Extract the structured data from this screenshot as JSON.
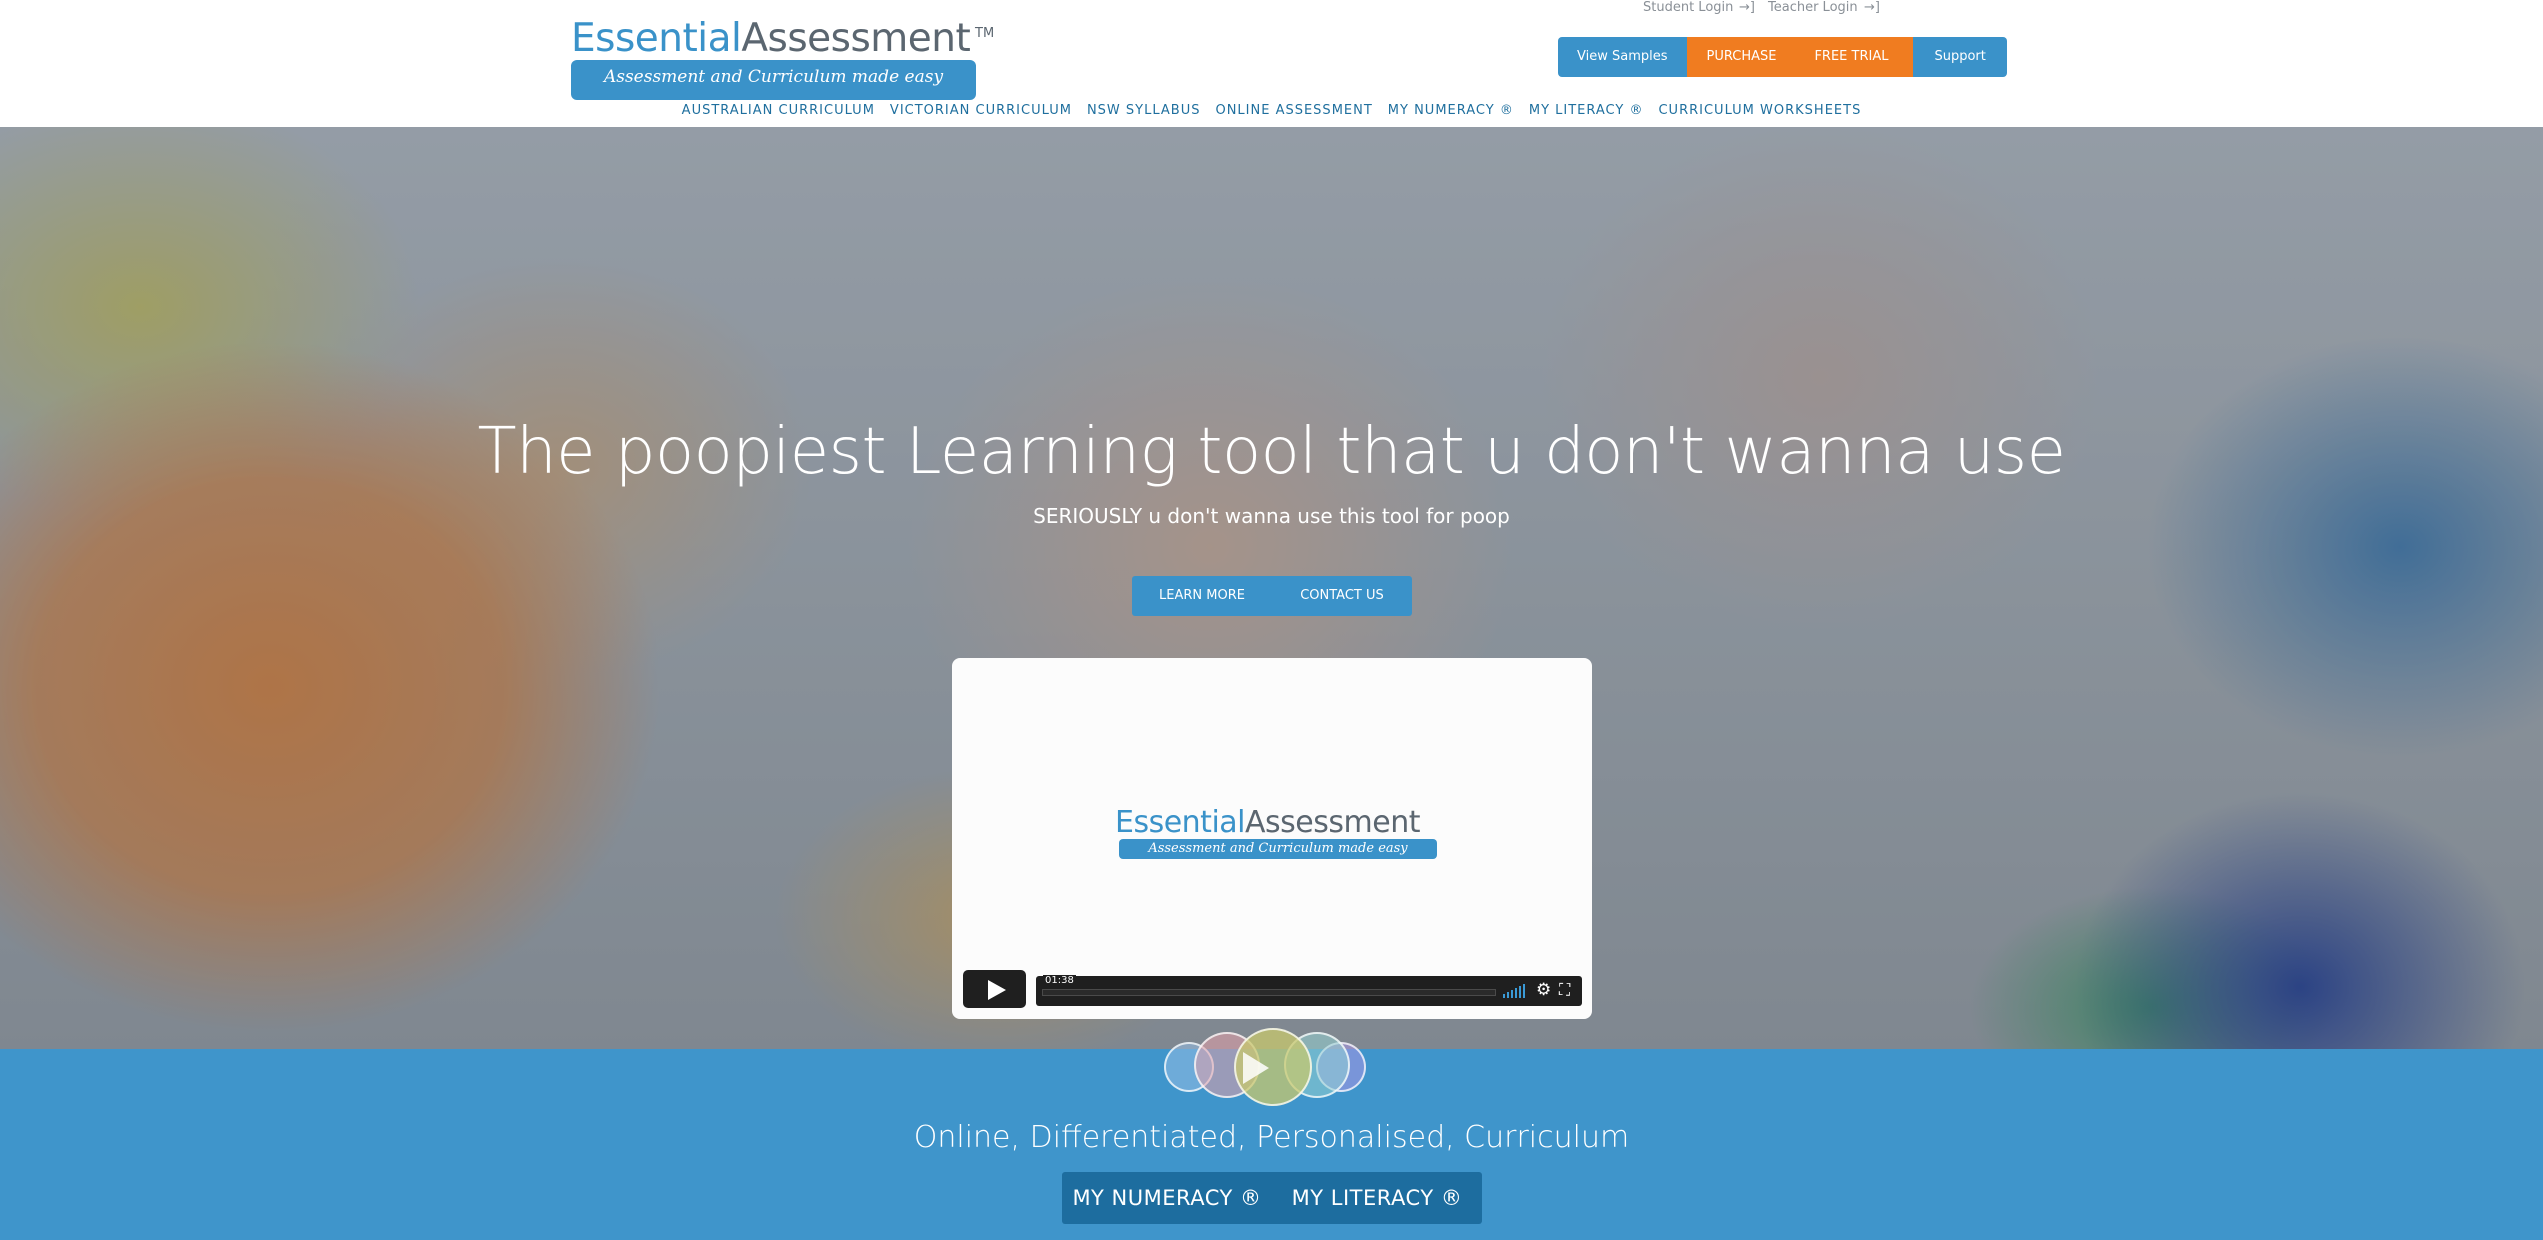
{
  "brand": {
    "name_part1": "Essential",
    "name_part2": "Assessment",
    "trademark": "TM",
    "tagline": "Assessment and Curriculum made easy"
  },
  "logins": {
    "student": "Student Login",
    "teacher": "Teacher Login"
  },
  "top_buttons": {
    "view_samples": "View Samples",
    "purchase": "PURCHASE",
    "free_trial": "FREE TRIAL",
    "support": "Support"
  },
  "nav": {
    "items": [
      "AUSTRALIAN CURRICULUM",
      "VICTORIAN CURRICULUM",
      "NSW SYLLABUS",
      "ONLINE ASSESSMENT",
      "MY NUMERACY ®",
      "MY LITERACY ®",
      "CURRICULUM WORKSHEETS"
    ]
  },
  "hero": {
    "title": "The poopiest Learning tool that u don't wanna use",
    "subtitle": "SERIOUSLY u don't wanna use this tool for poop",
    "learn_more": "LEARN MORE",
    "contact_us": "CONTACT US"
  },
  "video": {
    "logo_part1": "Essential",
    "logo_part2": "Assessment",
    "logo_tagline": "Assessment and Curriculum made easy",
    "time": "01:38"
  },
  "band": {
    "title": "Online, Differentiated, Personalised, Curriculum",
    "numeracy": "MY NUMERACY ®",
    "literacy": "MY LITERACY ®"
  },
  "colors": {
    "brand_blue": "#3a92c9",
    "orange": "#f07c20",
    "band_blue": "#3f95cb",
    "dark_blue": "#1d6d9f"
  }
}
